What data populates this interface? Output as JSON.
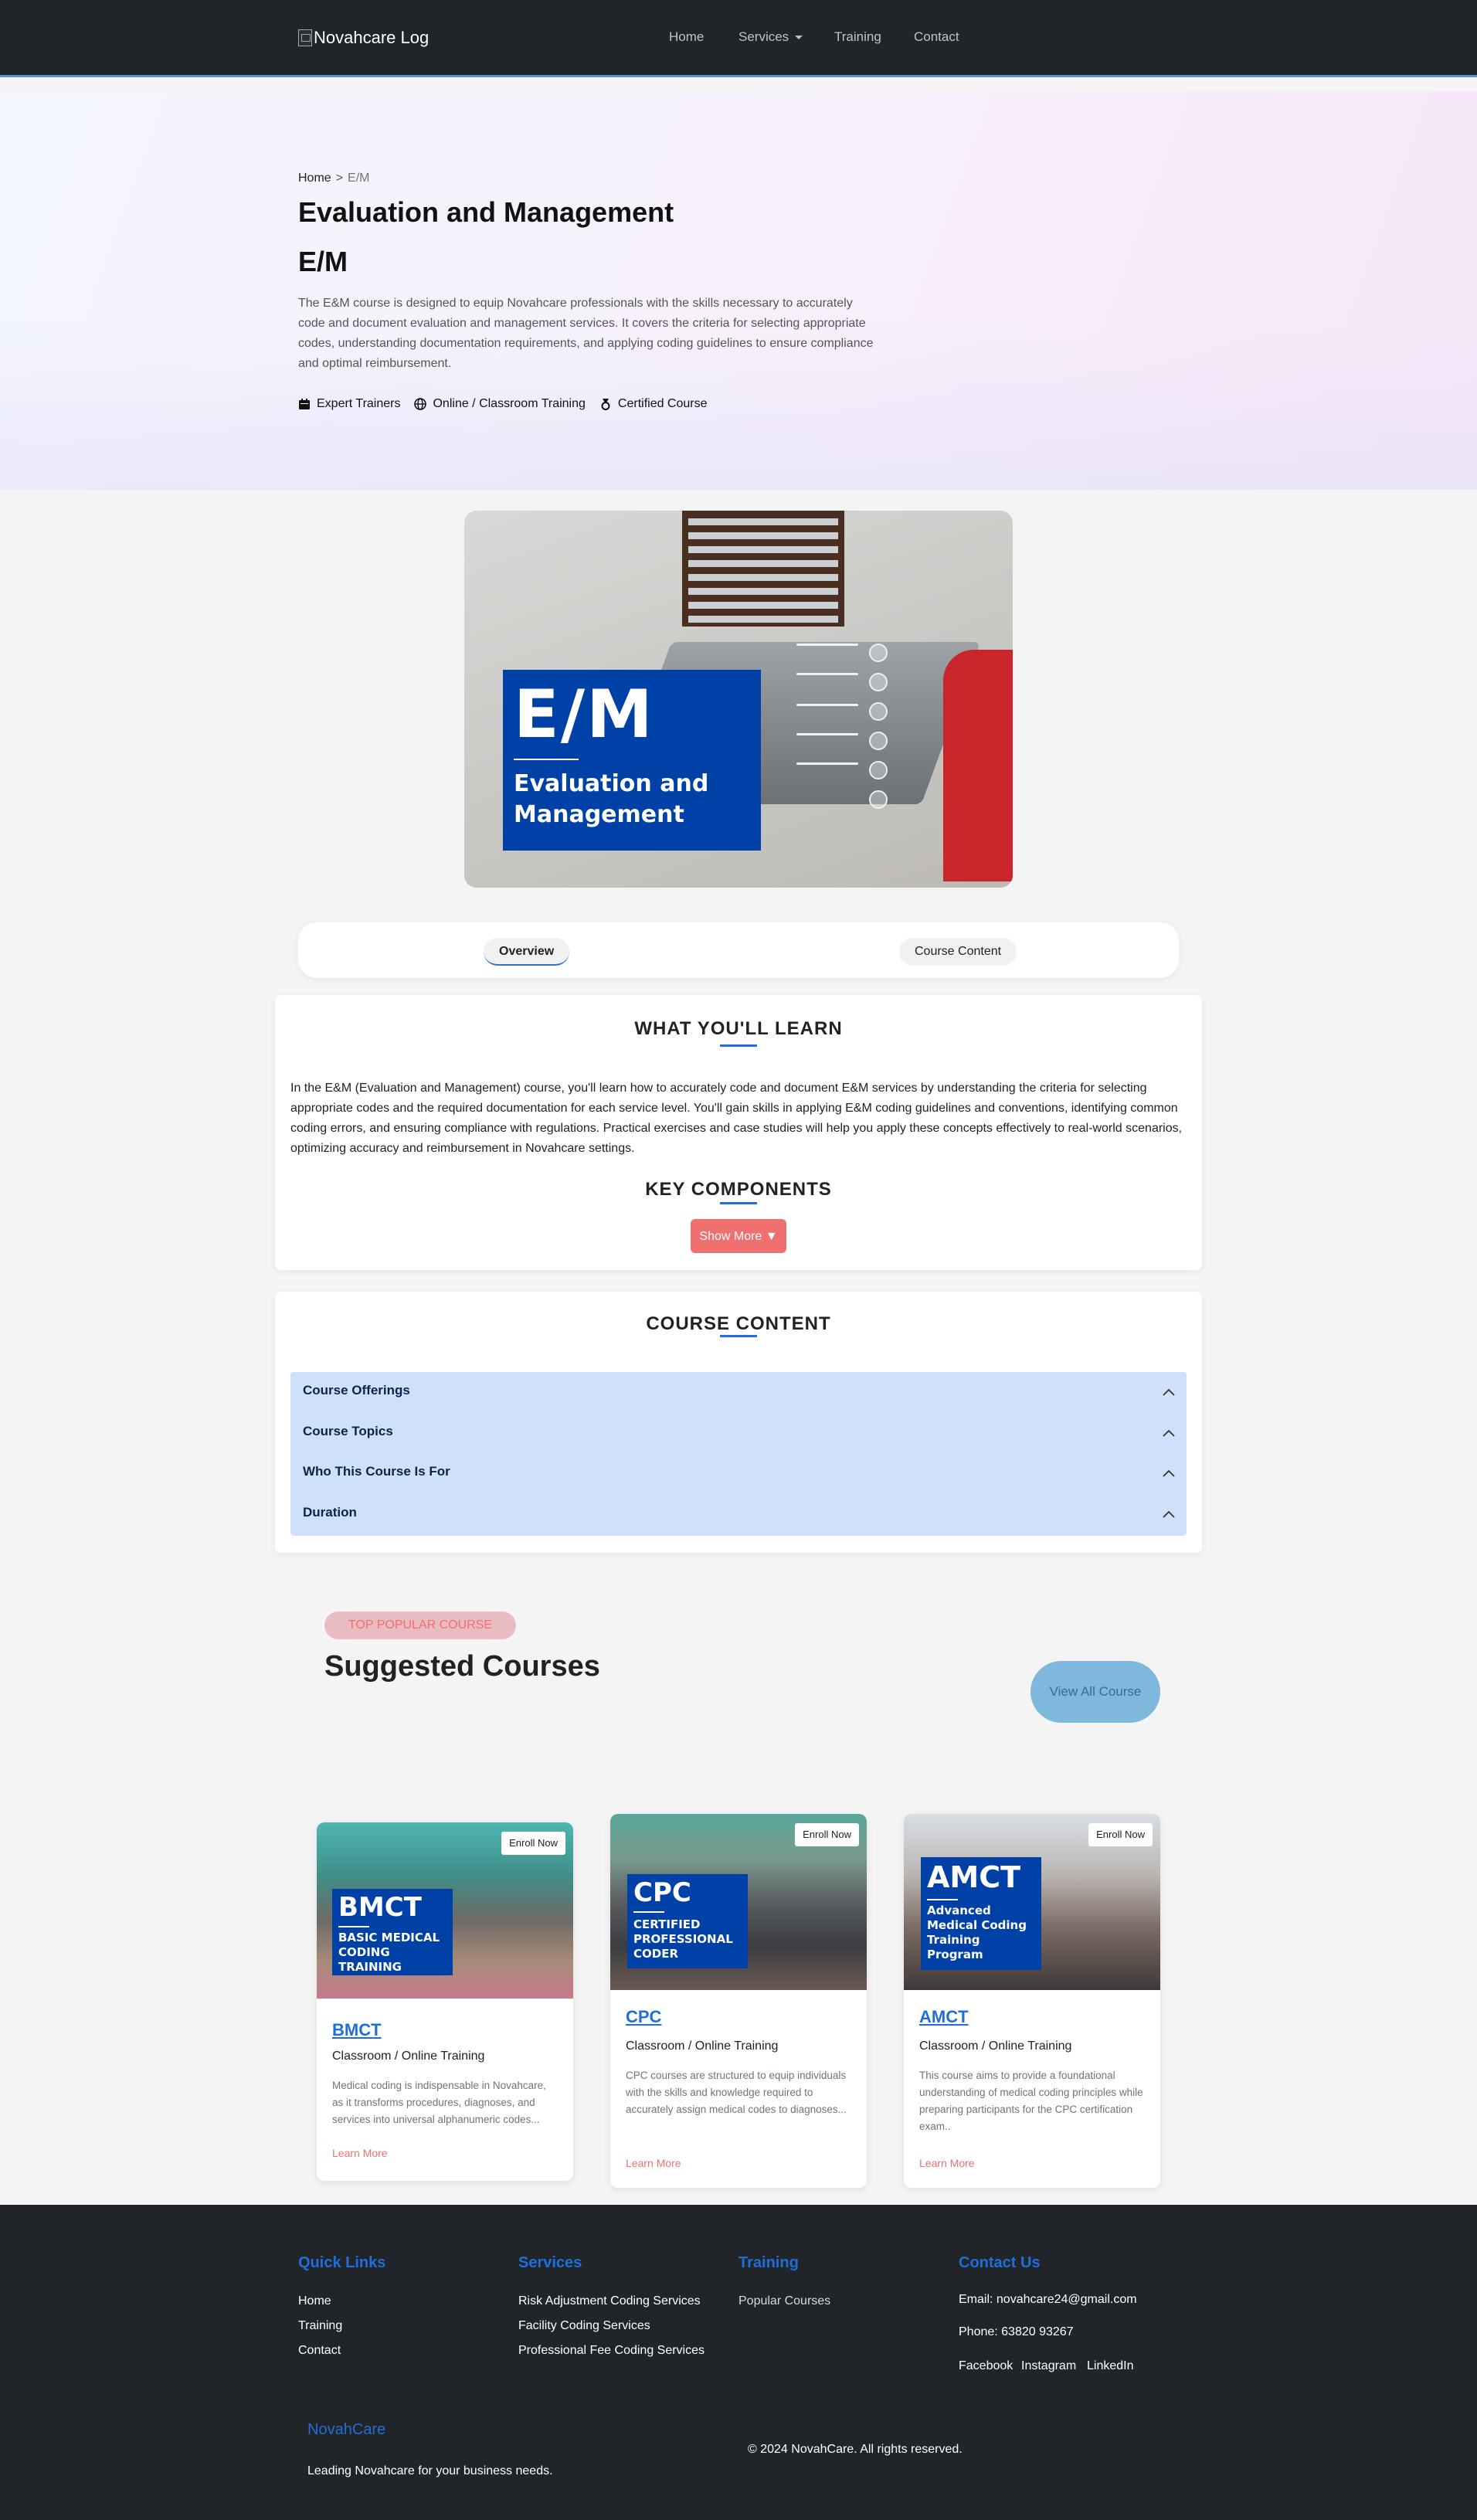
{
  "nav": {
    "logo_alt": "Novahcare Log",
    "links": [
      "Home",
      "Services",
      "Training",
      "Contact"
    ]
  },
  "hero": {
    "breadcrumb_home": "Home",
    "breadcrumb_sep": ">",
    "breadcrumb_current": "E/M",
    "title": "Evaluation and Management",
    "subtitle": "E/M",
    "description": "The E&M course is designed to equip Novahcare professionals with the skills necessary to accurately code and document evaluation and management services. It covers the criteria for selecting appropriate codes, understanding documentation requirements, and applying coding guidelines to ensure compliance and optimal reimbursement.",
    "features": [
      "Expert Trainers",
      "Online / Classroom Training",
      "Certified Course"
    ]
  },
  "course_image": {
    "big": "E/M",
    "small_line1": "Evaluation and",
    "small_line2": "Management"
  },
  "tabs": [
    "Overview",
    "Course Content"
  ],
  "learn": {
    "title": "WHAT YOU'LL LEARN",
    "text": "In the E&M (Evaluation and Management) course, you'll learn how to accurately code and document E&M services by understanding the criteria for selecting appropriate codes and the required documentation for each service level. You'll gain skills in applying E&M coding guidelines and conventions, identifying common coding errors, and ensuring compliance with regulations. Practical exercises and case studies will help you apply these concepts effectively to real-world scenarios, optimizing accuracy and reimbursement in Novahcare settings.",
    "key_title": "KEY COMPONENTS",
    "show_more": "Show More ▼"
  },
  "content": {
    "title": "COURSE CONTENT",
    "items": [
      "Course Offerings",
      "Course Topics",
      "Who This Course Is For",
      "Duration"
    ]
  },
  "suggested": {
    "pill": "TOP POPULAR COURSE",
    "title": "Suggested Courses",
    "view_all": "View All Course",
    "courses": [
      {
        "badge_title": "BMCT",
        "badge_lines": [
          "BASIC MEDICAL",
          "CODING",
          "TRAINING"
        ],
        "enroll": "Enroll Now",
        "name": "BMCT",
        "mode": "Classroom / Online Training",
        "desc": "Medical coding is indispensable in Novahcare, as it transforms procedures, diagnoses, and services into universal alphanumeric codes...",
        "learn_more": "Learn More"
      },
      {
        "badge_title": "CPC",
        "badge_lines": [
          "CERTIFIED",
          "PROFESSIONAL",
          "CODER"
        ],
        "enroll": "Enroll Now",
        "name": "CPC",
        "mode": "Classroom / Online Training",
        "desc": "CPC courses are structured to equip individuals with the skills and knowledge required to accurately assign medical codes to diagnoses...",
        "learn_more": "Learn More"
      },
      {
        "badge_title": "AMCT",
        "badge_lines": [
          "Advanced",
          "Medical Coding",
          "Training",
          "Program"
        ],
        "enroll": "Enroll Now",
        "name": "AMCT",
        "mode": "Classroom / Online Training",
        "desc": "This course aims to provide a foundational understanding of medical coding principles while preparing participants for the CPC certification exam..",
        "learn_more": "Learn More"
      }
    ]
  },
  "footer": {
    "quick_links": {
      "title": "Quick Links",
      "items": [
        "Home",
        "Training",
        "Contact"
      ]
    },
    "services": {
      "title": "Services",
      "items": [
        "Risk Adjustment Coding Services",
        "Facility Coding Services",
        "Professional Fee Coding Services"
      ]
    },
    "training": {
      "title": "Training",
      "items": [
        "Popular Courses"
      ]
    },
    "contact": {
      "title": "Contact Us",
      "email": "Email: novahcare24@gmail.com",
      "phone": "Phone: 63820 93267",
      "social": [
        "Facebook",
        "Instagram",
        "LinkedIn"
      ]
    },
    "brand": "NovahCare",
    "tagline": "Leading Novahcare for your business needs.",
    "copyright": "© 2024 NovahCare. All rights reserved."
  },
  "colors": {
    "nav_bg": "#212529",
    "accent_blue": "#1e6fd9",
    "accent_coral": "#f07070",
    "badge_blue": "#0041a8",
    "accordion_bg": "#cfe0fb"
  }
}
